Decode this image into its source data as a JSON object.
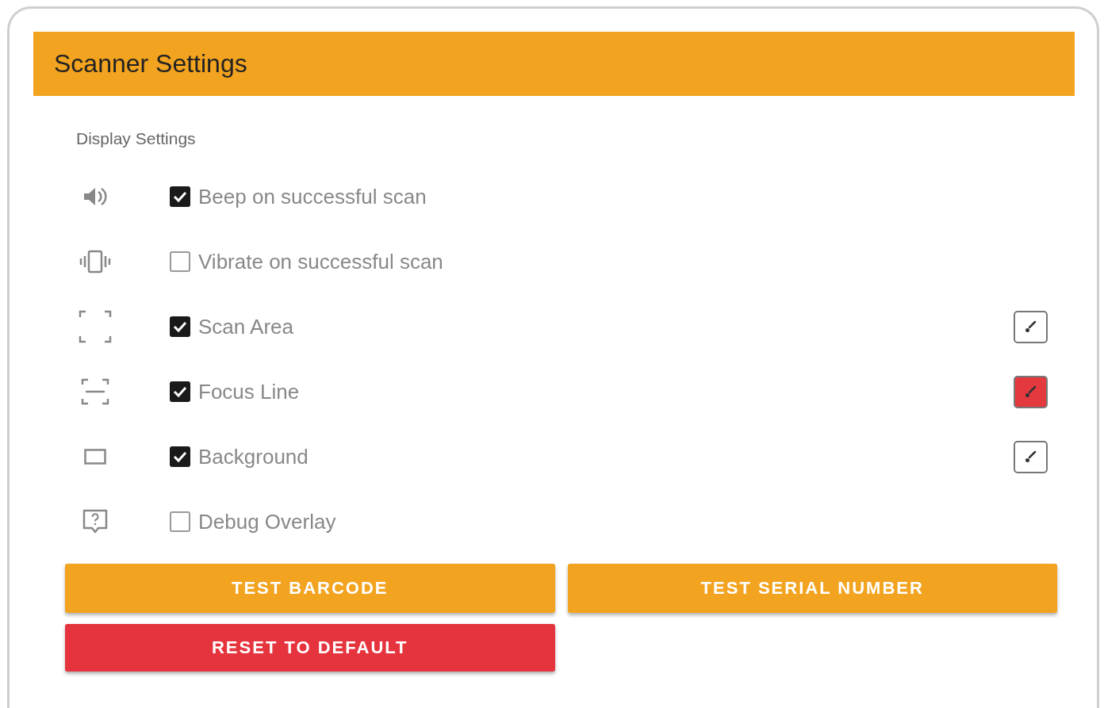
{
  "header": {
    "title": "Scanner Settings"
  },
  "section": {
    "title": "Display Settings"
  },
  "options": [
    {
      "label": "Beep on successful scan",
      "checked": true
    },
    {
      "label": "Vibrate on successful scan",
      "checked": false
    },
    {
      "label": "Scan Area",
      "checked": true,
      "color": "#ffffff"
    },
    {
      "label": "Focus Line",
      "checked": true,
      "color": "#e53940"
    },
    {
      "label": "Background",
      "checked": true,
      "color": "#ffffff"
    },
    {
      "label": "Debug Overlay",
      "checked": false
    }
  ],
  "buttons": [
    {
      "label": "TEST BARCODE",
      "kind": "primary"
    },
    {
      "label": "TEST SERIAL NUMBER",
      "kind": "primary"
    },
    {
      "label": "RESET TO DEFAULT",
      "kind": "danger"
    }
  ]
}
